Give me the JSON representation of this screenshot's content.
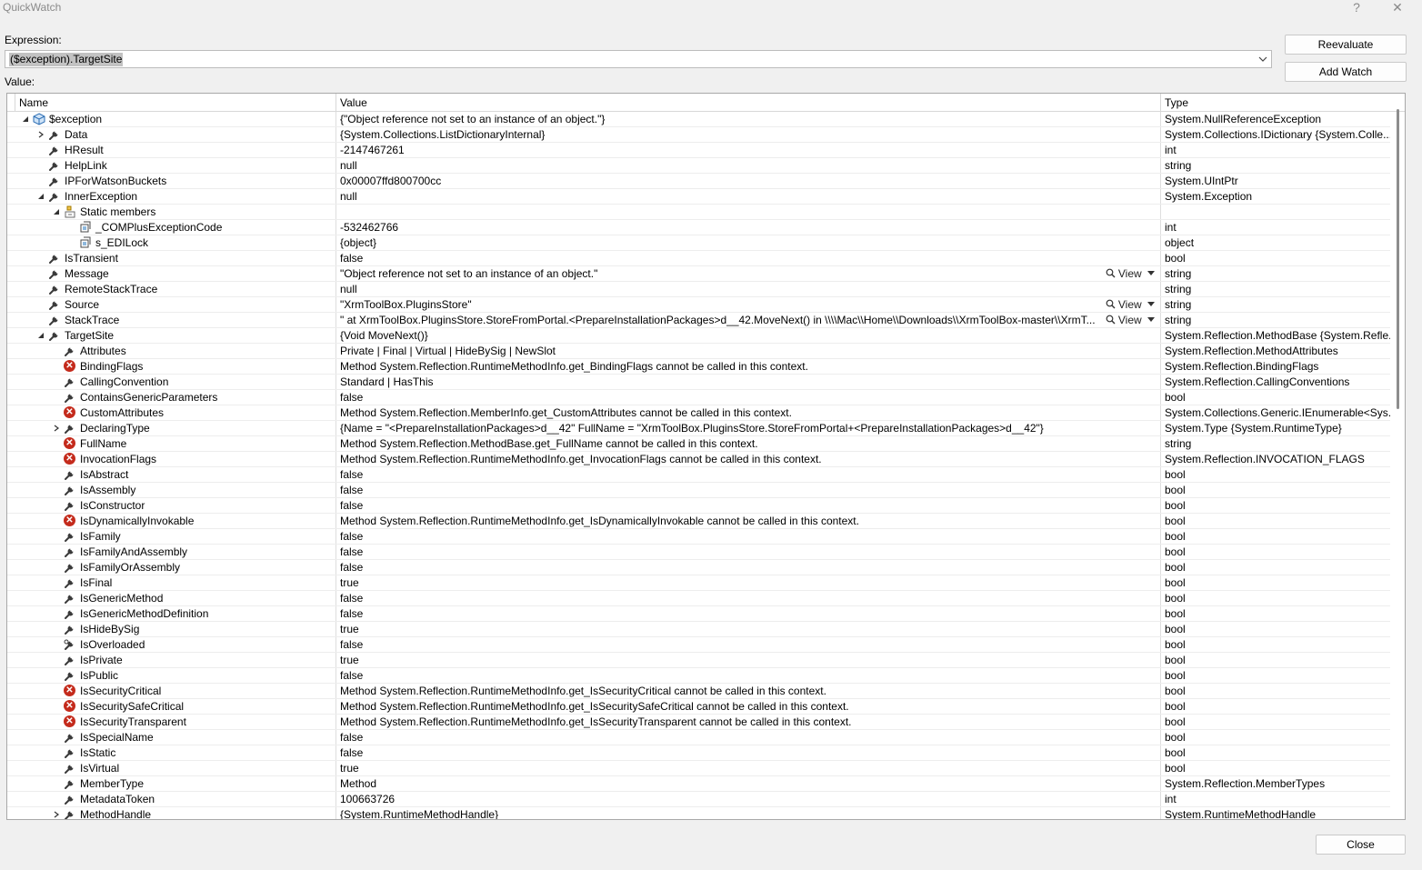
{
  "window": {
    "title": "QuickWatch",
    "help": "?",
    "close": "✕"
  },
  "expression": {
    "label": "Expression:",
    "value": "($exception).TargetSite"
  },
  "value_label": "Value:",
  "buttons": {
    "reevaluate": "Reevaluate",
    "add_watch": "Add Watch",
    "close": "Close"
  },
  "columns": {
    "name": "Name",
    "value": "Value",
    "type": "Type"
  },
  "view_label": "View",
  "rows": [
    {
      "name": "$exception",
      "value": "{\"Object reference not set to an instance of an object.\"}",
      "type": "System.NullReferenceException",
      "level": 0,
      "expander": "expanded",
      "icon": "exception"
    },
    {
      "name": "Data",
      "value": "{System.Collections.ListDictionaryInternal}",
      "type": "System.Collections.IDictionary {System.Colle...",
      "level": 1,
      "expander": "collapsed",
      "icon": "wrench"
    },
    {
      "name": "HResult",
      "value": "-2147467261",
      "type": "int",
      "level": 1,
      "expander": "none",
      "icon": "wrench"
    },
    {
      "name": "HelpLink",
      "value": "null",
      "type": "string",
      "level": 1,
      "expander": "none",
      "icon": "wrench"
    },
    {
      "name": "IPForWatsonBuckets",
      "value": "0x00007ffd800700cc",
      "type": "System.UIntPtr",
      "level": 1,
      "expander": "none",
      "icon": "wrench"
    },
    {
      "name": "InnerException",
      "value": "null",
      "type": "System.Exception",
      "level": 1,
      "expander": "expanded",
      "icon": "wrench"
    },
    {
      "name": "Static members",
      "value": "",
      "type": "",
      "level": 2,
      "expander": "expanded",
      "icon": "static"
    },
    {
      "name": "_COMPlusExceptionCode",
      "value": "-532462766",
      "type": "int",
      "level": 3,
      "expander": "none",
      "icon": "field"
    },
    {
      "name": "s_EDILock",
      "value": "{object}",
      "type": "object",
      "level": 3,
      "expander": "none",
      "icon": "field"
    },
    {
      "name": "IsTransient",
      "value": "false",
      "type": "bool",
      "level": 1,
      "expander": "none",
      "icon": "wrench"
    },
    {
      "name": "Message",
      "value": "\"Object reference not set to an instance of an object.\"",
      "type": "string",
      "level": 1,
      "expander": "none",
      "icon": "wrench",
      "view": true
    },
    {
      "name": "RemoteStackTrace",
      "value": "null",
      "type": "string",
      "level": 1,
      "expander": "none",
      "icon": "wrench"
    },
    {
      "name": "Source",
      "value": "\"XrmToolBox.PluginsStore\"",
      "type": "string",
      "level": 1,
      "expander": "none",
      "icon": "wrench",
      "view": true
    },
    {
      "name": "StackTrace",
      "value": "\"   at XrmToolBox.PluginsStore.StoreFromPortal.<PrepareInstallationPackages>d__42.MoveNext() in \\\\\\\\Mac\\\\Home\\\\Downloads\\\\XrmToolBox-master\\\\XrmT...",
      "type": "string",
      "level": 1,
      "expander": "none",
      "icon": "wrench",
      "view": true
    },
    {
      "name": "TargetSite",
      "value": "{Void MoveNext()}",
      "type": "System.Reflection.MethodBase {System.Refle...",
      "level": 1,
      "expander": "expanded",
      "icon": "wrench"
    },
    {
      "name": "Attributes",
      "value": "Private | Final | Virtual | HideBySig | NewSlot",
      "type": "System.Reflection.MethodAttributes",
      "level": 2,
      "expander": "none",
      "icon": "wrench"
    },
    {
      "name": "BindingFlags",
      "value": "Method System.Reflection.RuntimeMethodInfo.get_BindingFlags cannot be called in this context.",
      "type": "System.Reflection.BindingFlags",
      "level": 2,
      "expander": "none",
      "icon": "error"
    },
    {
      "name": "CallingConvention",
      "value": "Standard | HasThis",
      "type": "System.Reflection.CallingConventions",
      "level": 2,
      "expander": "none",
      "icon": "wrench"
    },
    {
      "name": "ContainsGenericParameters",
      "value": "false",
      "type": "bool",
      "level": 2,
      "expander": "none",
      "icon": "wrench"
    },
    {
      "name": "CustomAttributes",
      "value": "Method System.Reflection.MemberInfo.get_CustomAttributes cannot be called in this context.",
      "type": "System.Collections.Generic.IEnumerable<Sys...",
      "level": 2,
      "expander": "none",
      "icon": "error"
    },
    {
      "name": "DeclaringType",
      "value": "{Name = \"<PrepareInstallationPackages>d__42\" FullName = \"XrmToolBox.PluginsStore.StoreFromPortal+<PrepareInstallationPackages>d__42\"}",
      "type": "System.Type {System.RuntimeType}",
      "level": 2,
      "expander": "collapsed",
      "icon": "wrench"
    },
    {
      "name": "FullName",
      "value": "Method System.Reflection.MethodBase.get_FullName cannot be called in this context.",
      "type": "string",
      "level": 2,
      "expander": "none",
      "icon": "error"
    },
    {
      "name": "InvocationFlags",
      "value": "Method System.Reflection.RuntimeMethodInfo.get_InvocationFlags cannot be called in this context.",
      "type": "System.Reflection.INVOCATION_FLAGS",
      "level": 2,
      "expander": "none",
      "icon": "error"
    },
    {
      "name": "IsAbstract",
      "value": "false",
      "type": "bool",
      "level": 2,
      "expander": "none",
      "icon": "wrench"
    },
    {
      "name": "IsAssembly",
      "value": "false",
      "type": "bool",
      "level": 2,
      "expander": "none",
      "icon": "wrench"
    },
    {
      "name": "IsConstructor",
      "value": "false",
      "type": "bool",
      "level": 2,
      "expander": "none",
      "icon": "wrench"
    },
    {
      "name": "IsDynamicallyInvokable",
      "value": "Method System.Reflection.RuntimeMethodInfo.get_IsDynamicallyInvokable cannot be called in this context.",
      "type": "bool",
      "level": 2,
      "expander": "none",
      "icon": "error"
    },
    {
      "name": "IsFamily",
      "value": "false",
      "type": "bool",
      "level": 2,
      "expander": "none",
      "icon": "wrench"
    },
    {
      "name": "IsFamilyAndAssembly",
      "value": "false",
      "type": "bool",
      "level": 2,
      "expander": "none",
      "icon": "wrench"
    },
    {
      "name": "IsFamilyOrAssembly",
      "value": "false",
      "type": "bool",
      "level": 2,
      "expander": "none",
      "icon": "wrench"
    },
    {
      "name": "IsFinal",
      "value": "true",
      "type": "bool",
      "level": 2,
      "expander": "none",
      "icon": "wrench"
    },
    {
      "name": "IsGenericMethod",
      "value": "false",
      "type": "bool",
      "level": 2,
      "expander": "none",
      "icon": "wrench"
    },
    {
      "name": "IsGenericMethodDefinition",
      "value": "false",
      "type": "bool",
      "level": 2,
      "expander": "none",
      "icon": "wrench"
    },
    {
      "name": "IsHideBySig",
      "value": "true",
      "type": "bool",
      "level": 2,
      "expander": "none",
      "icon": "wrench"
    },
    {
      "name": "IsOverloaded",
      "value": "false",
      "type": "bool",
      "level": 2,
      "expander": "none",
      "icon": "wrench2"
    },
    {
      "name": "IsPrivate",
      "value": "true",
      "type": "bool",
      "level": 2,
      "expander": "none",
      "icon": "wrench"
    },
    {
      "name": "IsPublic",
      "value": "false",
      "type": "bool",
      "level": 2,
      "expander": "none",
      "icon": "wrench"
    },
    {
      "name": "IsSecurityCritical",
      "value": "Method System.Reflection.RuntimeMethodInfo.get_IsSecurityCritical cannot be called in this context.",
      "type": "bool",
      "level": 2,
      "expander": "none",
      "icon": "error"
    },
    {
      "name": "IsSecuritySafeCritical",
      "value": "Method System.Reflection.RuntimeMethodInfo.get_IsSecuritySafeCritical cannot be called in this context.",
      "type": "bool",
      "level": 2,
      "expander": "none",
      "icon": "error"
    },
    {
      "name": "IsSecurityTransparent",
      "value": "Method System.Reflection.RuntimeMethodInfo.get_IsSecurityTransparent cannot be called in this context.",
      "type": "bool",
      "level": 2,
      "expander": "none",
      "icon": "error"
    },
    {
      "name": "IsSpecialName",
      "value": "false",
      "type": "bool",
      "level": 2,
      "expander": "none",
      "icon": "wrench"
    },
    {
      "name": "IsStatic",
      "value": "false",
      "type": "bool",
      "level": 2,
      "expander": "none",
      "icon": "wrench"
    },
    {
      "name": "IsVirtual",
      "value": "true",
      "type": "bool",
      "level": 2,
      "expander": "none",
      "icon": "wrench"
    },
    {
      "name": "MemberType",
      "value": "Method",
      "type": "System.Reflection.MemberTypes",
      "level": 2,
      "expander": "none",
      "icon": "wrench"
    },
    {
      "name": "MetadataToken",
      "value": "100663726",
      "type": "int",
      "level": 2,
      "expander": "none",
      "icon": "wrench"
    },
    {
      "name": "MethodHandle",
      "value": "{System.RuntimeMethodHandle}",
      "type": "System.RuntimeMethodHandle",
      "level": 2,
      "expander": "collapsed",
      "icon": "wrench"
    }
  ]
}
